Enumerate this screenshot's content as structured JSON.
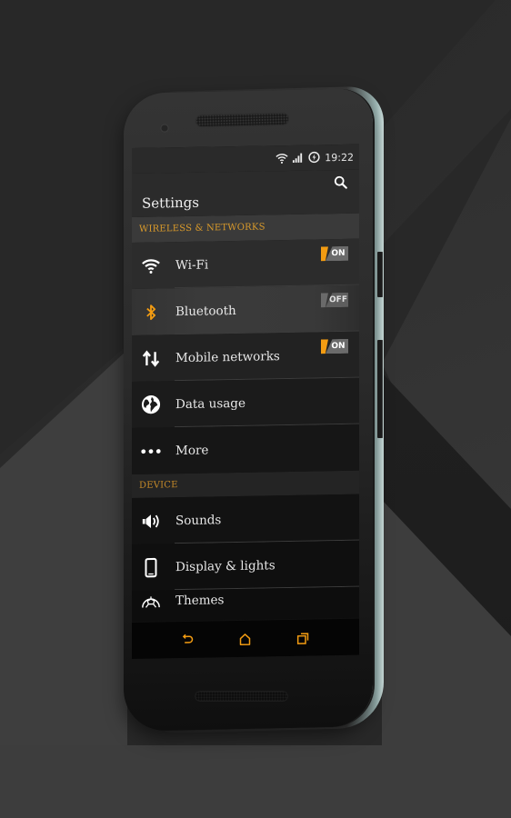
{
  "status_bar": {
    "time": "19:22",
    "icons": [
      "wifi-icon",
      "signal-icon",
      "battery-charging-icon"
    ]
  },
  "app_bar": {
    "title": "Settings",
    "search_icon": "search-icon"
  },
  "sections": [
    {
      "header": "WIRELESS & NETWORKS",
      "items": [
        {
          "label": "Wi-Fi",
          "icon": "wifi-icon",
          "toggle": "ON"
        },
        {
          "label": "Bluetooth",
          "icon": "bluetooth-icon",
          "toggle": "OFF"
        },
        {
          "label": "Mobile networks",
          "icon": "data-arrows-icon",
          "toggle": "ON"
        },
        {
          "label": "Data usage",
          "icon": "globe-icon"
        },
        {
          "label": "More",
          "icon": "more-dots-icon"
        }
      ]
    },
    {
      "header": "DEVICE",
      "items": [
        {
          "label": "Sounds",
          "icon": "speaker-icon"
        },
        {
          "label": "Display & lights",
          "icon": "phone-display-icon"
        },
        {
          "label": "Themes",
          "icon": "themes-icon"
        }
      ]
    }
  ],
  "nav_bar": {
    "buttons": [
      "back-icon",
      "home-icon",
      "recents-icon"
    ]
  },
  "colors": {
    "accent": "#f39c12",
    "section_header_text": "#d99a2b",
    "toggle_off": "#6a6a6a"
  }
}
